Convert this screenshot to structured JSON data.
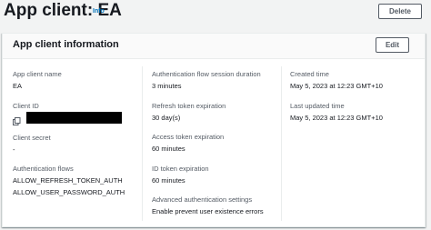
{
  "header": {
    "title": "App client: EA",
    "info_label": "Info",
    "delete_label": "Delete"
  },
  "panel": {
    "title": "App client information",
    "edit_label": "Edit",
    "fields": {
      "app_client_name": {
        "label": "App client name",
        "value": "EA"
      },
      "client_id": {
        "label": "Client ID",
        "value_redacted": true
      },
      "client_secret": {
        "label": "Client secret",
        "value": "-"
      },
      "auth_flows": {
        "label": "Authentication flows",
        "values": [
          "ALLOW_REFRESH_TOKEN_AUTH",
          "ALLOW_USER_PASSWORD_AUTH"
        ]
      },
      "auth_session_duration": {
        "label": "Authentication flow session duration",
        "value": "3 minutes"
      },
      "refresh_token_expiration": {
        "label": "Refresh token expiration",
        "value": "30 day(s)"
      },
      "access_token_expiration": {
        "label": "Access token expiration",
        "value": "60 minutes"
      },
      "id_token_expiration": {
        "label": "ID token expiration",
        "value": "60 minutes"
      },
      "advanced_auth_settings": {
        "label": "Advanced authentication settings",
        "value": "Enable prevent user existence errors"
      },
      "created_time": {
        "label": "Created time",
        "value": "May 5, 2023 at 12:23 GMT+10"
      },
      "last_updated_time": {
        "label": "Last updated time",
        "value": "May 5, 2023 at 12:23 GMT+10"
      }
    }
  },
  "icons": {
    "copy": "copy-icon"
  },
  "colors": {
    "link": "#0073bb",
    "text": "#16191f",
    "label": "#545b64",
    "background": "#f2f3f3"
  }
}
